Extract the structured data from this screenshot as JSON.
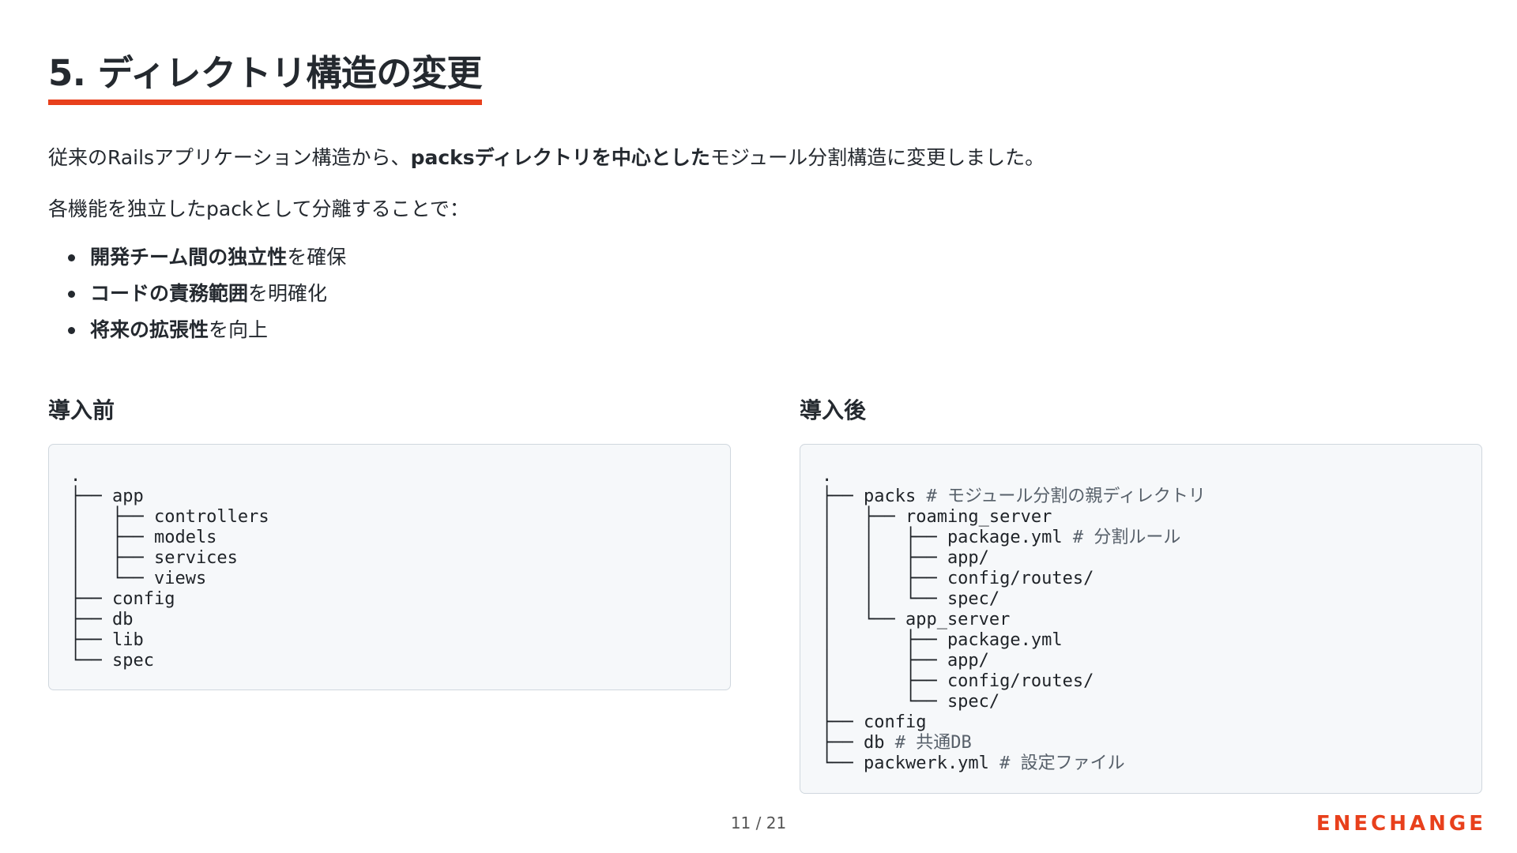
{
  "title": "5. ディレクトリ構造の変更",
  "intro": {
    "prefix": "従来のRailsアプリケーション構造から、",
    "bold": "packsディレクトリを中心とした",
    "suffix": "モジュール分割構造に変更しました。"
  },
  "lead": "各機能を独立したpackとして分離することで：",
  "bullets": [
    {
      "bold": "開発チーム間の独立性",
      "rest": "を確保"
    },
    {
      "bold": "コードの責務範囲",
      "rest": "を明確化"
    },
    {
      "bold": "将来の拡張性",
      "rest": "を向上"
    }
  ],
  "before": {
    "heading": "導入前",
    "lines": [
      {
        "code": ".",
        "comment": ""
      },
      {
        "code": "├── app",
        "comment": ""
      },
      {
        "code": "│   ├── controllers",
        "comment": ""
      },
      {
        "code": "│   ├── models",
        "comment": ""
      },
      {
        "code": "│   ├── services",
        "comment": ""
      },
      {
        "code": "│   └── views",
        "comment": ""
      },
      {
        "code": "├── config",
        "comment": ""
      },
      {
        "code": "├── db",
        "comment": ""
      },
      {
        "code": "├── lib",
        "comment": ""
      },
      {
        "code": "└── spec",
        "comment": ""
      }
    ]
  },
  "after": {
    "heading": "導入後",
    "lines": [
      {
        "code": ".",
        "comment": ""
      },
      {
        "code": "├── packs ",
        "comment": "# モジュール分割の親ディレクトリ"
      },
      {
        "code": "│   ├── roaming_server",
        "comment": ""
      },
      {
        "code": "│   │   ├── package.yml ",
        "comment": "# 分割ルール"
      },
      {
        "code": "│   │   ├── app/",
        "comment": ""
      },
      {
        "code": "│   │   ├── config/routes/",
        "comment": ""
      },
      {
        "code": "│   │   └── spec/",
        "comment": ""
      },
      {
        "code": "│   └── app_server",
        "comment": ""
      },
      {
        "code": "│       ├── package.yml",
        "comment": ""
      },
      {
        "code": "│       ├── app/",
        "comment": ""
      },
      {
        "code": "│       ├── config/routes/",
        "comment": ""
      },
      {
        "code": "│       └── spec/",
        "comment": ""
      },
      {
        "code": "├── config",
        "comment": ""
      },
      {
        "code": "├── db ",
        "comment": "# 共通DB"
      },
      {
        "code": "└── packwerk.yml ",
        "comment": "# 設定ファイル"
      }
    ]
  },
  "pager": "11 / 21",
  "logo": "ENECHANGE",
  "colors": {
    "accent": "#e8401c",
    "text": "#24292f",
    "code_bg": "#f6f8fa",
    "code_border": "#d0d7de",
    "comment": "#57606a"
  }
}
